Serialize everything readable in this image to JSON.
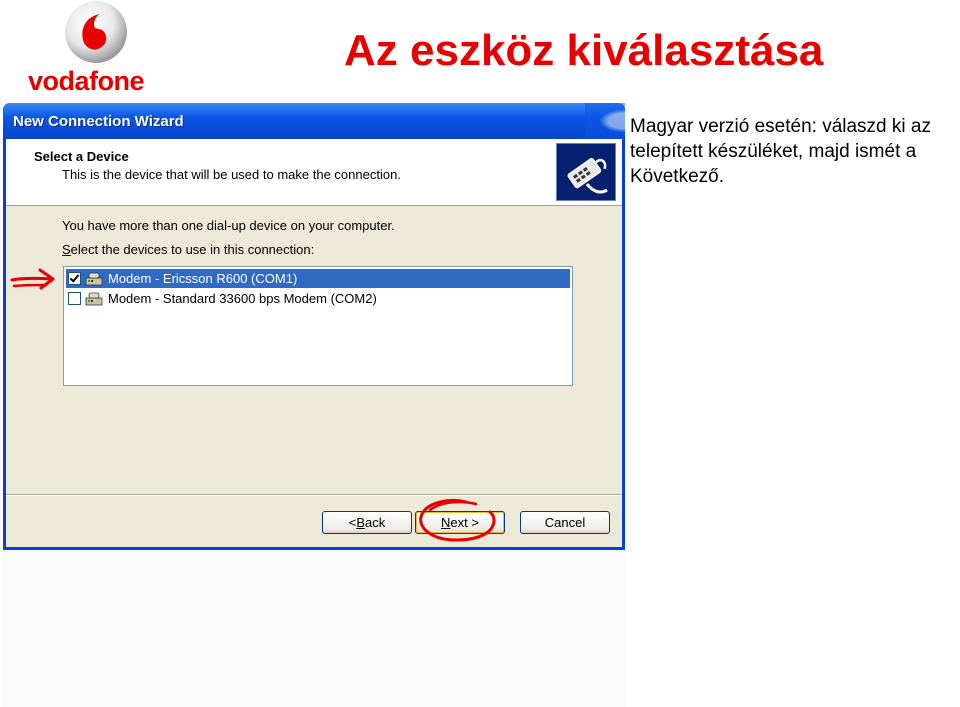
{
  "brand": {
    "logo_text": "vodafone",
    "color": "#e60000"
  },
  "slide": {
    "title": "Az eszköz kiválasztása",
    "instruction": "Magyar verzió esetén: válaszd ki az telepített készüléket, majd ismét a Következő."
  },
  "wizard": {
    "window_title": "New Connection Wizard",
    "header_title": "Select a Device",
    "header_subtitle": "This is the device that will be used to make the connection.",
    "intro_line": "You have more than one dial-up device on your computer.",
    "select_prefix": "S",
    "select_rest": "elect the devices to use in this connection:",
    "devices": [
      {
        "label": "Modem - Ericsson R600 (COM1)",
        "checked": true,
        "selected": true
      },
      {
        "label": "Modem - Standard 33600 bps Modem (COM2)",
        "checked": false,
        "selected": false
      }
    ],
    "buttons": {
      "back_prefix": "< ",
      "back_accel": "B",
      "back_rest": "ack",
      "next_accel": "N",
      "next_rest": "ext >",
      "cancel": "Cancel"
    }
  },
  "icons": {
    "header": "connection-wizard-icon",
    "device": "modem-icon"
  },
  "colors": {
    "title_bar": "#0a55e6",
    "selection": "#316ac5",
    "annotation": "#e60000"
  }
}
